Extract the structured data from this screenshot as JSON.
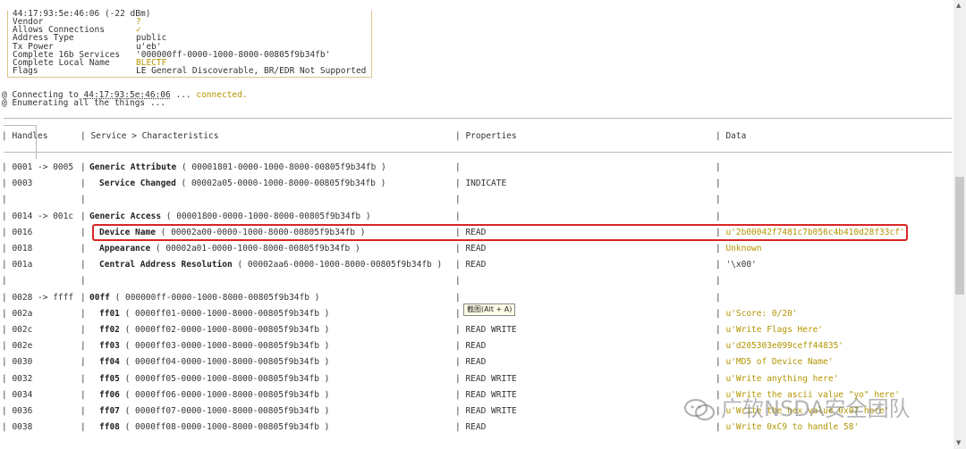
{
  "device": {
    "header": "44:17:93:5e:46:06 (-22 dBm)",
    "fields": [
      {
        "key": "Vendor",
        "value": "?",
        "highlight": true
      },
      {
        "key": "Allows Connections",
        "value": "✓",
        "highlight": true
      },
      {
        "key": "Address Type",
        "value": "public",
        "highlight": false
      },
      {
        "key": "Tx Power",
        "value": "u'eb'",
        "highlight": false
      },
      {
        "key": "Complete 16b Services",
        "value": "'000000ff-0000-1000-8000-00805f9b34fb'",
        "highlight": false
      },
      {
        "key": "Complete Local Name",
        "value": "BLECTF",
        "highlight": true
      },
      {
        "key": "Flags",
        "value": "LE General Discoverable, BR/EDR Not Supported",
        "highlight": false
      }
    ]
  },
  "log": {
    "connecting_prefix": "@ Connecting to ",
    "connecting_address": "44:17:93:5e:46:06",
    "connecting_dots": " ... ",
    "connected": "connected.",
    "enumerating": "@ Enumerating all the things ..."
  },
  "table": {
    "headers": {
      "handles": "| Handles",
      "service": "| Service > Characteristics",
      "properties": "| Properties",
      "data": "| Data"
    },
    "rows": [
      {
        "handles": "| 0001 -> 0005",
        "service_name": "Generic Attribute",
        "service_uuid": " ( 00001801-0000-1000-8000-00805f9b34fb )",
        "indent": false,
        "properties": "|",
        "data": "|",
        "data_yellow": false
      },
      {
        "handles": "| 0003",
        "service_name": "Service Changed",
        "service_uuid": " ( 00002a05-0000-1000-8000-00805f9b34fb )",
        "indent": true,
        "properties": "| INDICATE",
        "data": "|",
        "data_yellow": false
      },
      {
        "handles": "|",
        "service_name": "",
        "service_uuid": "",
        "indent": false,
        "properties": "|",
        "data": "|",
        "data_yellow": false
      },
      {
        "handles": "| 0014 -> 001c",
        "service_name": "Generic Access",
        "service_uuid": " ( 00001800-0000-1000-8000-00805f9b34fb )",
        "indent": false,
        "properties": "|",
        "data": "|",
        "data_yellow": false
      },
      {
        "handles": "| 0016",
        "service_name": "Device Name",
        "service_uuid": " ( 00002a00-0000-1000-8000-00805f9b34fb )",
        "indent": true,
        "properties": "| READ",
        "data": "| u'2b00042f7481c7b056c4b410d28f33cf'",
        "data_yellow": true
      },
      {
        "handles": "| 0018",
        "service_name": "Appearance",
        "service_uuid": " ( 00002a01-0000-1000-8000-00805f9b34fb )",
        "indent": true,
        "properties": "| READ",
        "data": "| Unknown",
        "data_yellow": true
      },
      {
        "handles": "| 001a",
        "service_name": "Central Address Resolution",
        "service_uuid": " ( 00002aa6-0000-1000-8000-00805f9b34fb )",
        "indent": true,
        "properties": "| READ",
        "data": "| '\\x00'",
        "data_yellow": false
      },
      {
        "handles": "|",
        "service_name": "",
        "service_uuid": "",
        "indent": false,
        "properties": "|",
        "data": "|",
        "data_yellow": false
      },
      {
        "handles": "| 0028 -> ffff",
        "service_name": "00ff",
        "service_uuid": " ( 000000ff-0000-1000-8000-00805f9b34fb )",
        "indent": false,
        "properties": "|",
        "data": "|",
        "data_yellow": false
      },
      {
        "handles": "| 002a",
        "service_name": "ff01",
        "service_uuid": " ( 0000ff01-0000-1000-8000-00805f9b34fb )",
        "indent": true,
        "properties": "| READ",
        "data": "| u'Score: 0/20'",
        "data_yellow": true
      },
      {
        "handles": "| 002c",
        "service_name": "ff02",
        "service_uuid": " ( 0000ff02-0000-1000-8000-00805f9b34fb )",
        "indent": true,
        "properties": "| READ WRITE",
        "data": "| u'Write Flags Here'",
        "data_yellow": true
      },
      {
        "handles": "| 002e",
        "service_name": "ff03",
        "service_uuid": " ( 0000ff03-0000-1000-8000-00805f9b34fb )",
        "indent": true,
        "properties": "| READ",
        "data": "| u'd205303e099ceff44835'",
        "data_yellow": true
      },
      {
        "handles": "| 0030",
        "service_name": "ff04",
        "service_uuid": " ( 0000ff04-0000-1000-8000-00805f9b34fb )",
        "indent": true,
        "properties": "| READ",
        "data": "| u'MD5 of Device Name'",
        "data_yellow": true
      },
      {
        "handles": "| 0032",
        "service_name": "ff05",
        "service_uuid": " ( 0000ff05-0000-1000-8000-00805f9b34fb )",
        "indent": true,
        "properties": "| READ WRITE",
        "data": "| u'Write anything here'",
        "data_yellow": true
      },
      {
        "handles": "| 0034",
        "service_name": "ff06",
        "service_uuid": " ( 0000ff06-0000-1000-8000-00805f9b34fb )",
        "indent": true,
        "properties": "| READ WRITE",
        "data": "| u'Write the ascii value \"yo\" here'",
        "data_yellow": true
      },
      {
        "handles": "| 0036",
        "service_name": "ff07",
        "service_uuid": " ( 0000ff07-0000-1000-8000-00805f9b34fb )",
        "indent": true,
        "properties": "| READ WRITE",
        "data": "| u'Write the hex value 0x07 here'",
        "data_yellow": true
      },
      {
        "handles": "| 0038",
        "service_name": "ff08",
        "service_uuid": " ( 0000ff08-0000-1000-8000-00805f9b34fb )",
        "indent": true,
        "properties": "| READ",
        "data": "| u'Write 0xC9 to handle 58'",
        "data_yellow": true
      }
    ]
  },
  "tooltip": "截图(Alt + A)",
  "watermark": "广软NSDA安全团队",
  "colors": {
    "highlight_box": "#d92525",
    "value_yellow": "#b39500"
  }
}
